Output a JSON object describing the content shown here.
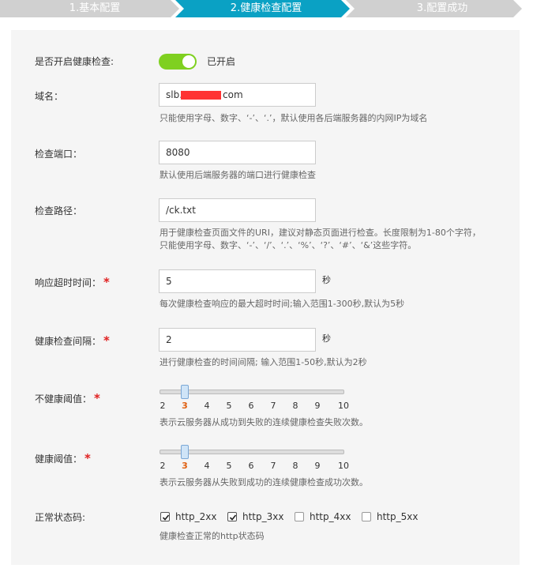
{
  "steps": [
    {
      "label": "1.基本配置",
      "state": "done"
    },
    {
      "label": "2.健康检查配置",
      "state": "active"
    },
    {
      "label": "3.配置成功",
      "state": "pending"
    }
  ],
  "colors": {
    "step_active": "#0aa1c4",
    "step_inactive": "#d0d0d0",
    "toggle_on": "#7fd020",
    "required_mark": "#e02020",
    "slider_active_tick": "#e06010"
  },
  "form": {
    "health_check": {
      "label": "是否开启健康检查:",
      "enabled": true,
      "status_text": "已开启"
    },
    "domain": {
      "label": "域名：",
      "value_prefix": "slb.",
      "value_suffix": "com",
      "hint": "只能使用字母、数字、‘-’、‘.’，默认使用各后端服务器的内网IP为域名"
    },
    "port": {
      "label": "检查端口：",
      "value": "8080",
      "hint": "默认使用后端服务器的端口进行健康检查"
    },
    "path": {
      "label": "检查路径：",
      "value": "/ck.txt",
      "hint_line1": "用于健康检查页面文件的URI，建议对静态页面进行检查。长度限制为1-80个字符，",
      "hint_line2": "只能使用字母、数字、‘-’、‘/’、‘.’、‘%’、‘?’、‘#’、‘&’这些字符。"
    },
    "timeout": {
      "label": "响应超时时间：",
      "required": "*",
      "value": "5",
      "unit": "秒",
      "hint": "每次健康检查响应的最大超时时间;输入范围1-300秒,默认为5秒"
    },
    "interval": {
      "label": "健康检查间隔：",
      "required": "*",
      "value": "2",
      "unit": "秒",
      "hint": "进行健康检查的时间间隔; 输入范围1-50秒,默认为2秒"
    },
    "unhealthy_threshold": {
      "label": "不健康阈值：",
      "required": "*",
      "ticks": [
        "2",
        "3",
        "4",
        "5",
        "6",
        "7",
        "8",
        "9",
        "10"
      ],
      "value": 3,
      "hint": "表示云服务器从成功到失败的连续健康检查失败次数。"
    },
    "healthy_threshold": {
      "label": "健康阈值：",
      "required": "*",
      "ticks": [
        "2",
        "3",
        "4",
        "5",
        "6",
        "7",
        "8",
        "9",
        "10"
      ],
      "value": 3,
      "hint": "表示云服务器从失败到成功的连续健康检查成功次数。"
    },
    "status_codes": {
      "label": "正常状态码:",
      "options": [
        {
          "label": "http_2xx",
          "checked": true
        },
        {
          "label": "http_3xx",
          "checked": true
        },
        {
          "label": "http_4xx",
          "checked": false
        },
        {
          "label": "http_5xx",
          "checked": false
        }
      ],
      "hint": "健康检查正常的http状态码"
    }
  }
}
